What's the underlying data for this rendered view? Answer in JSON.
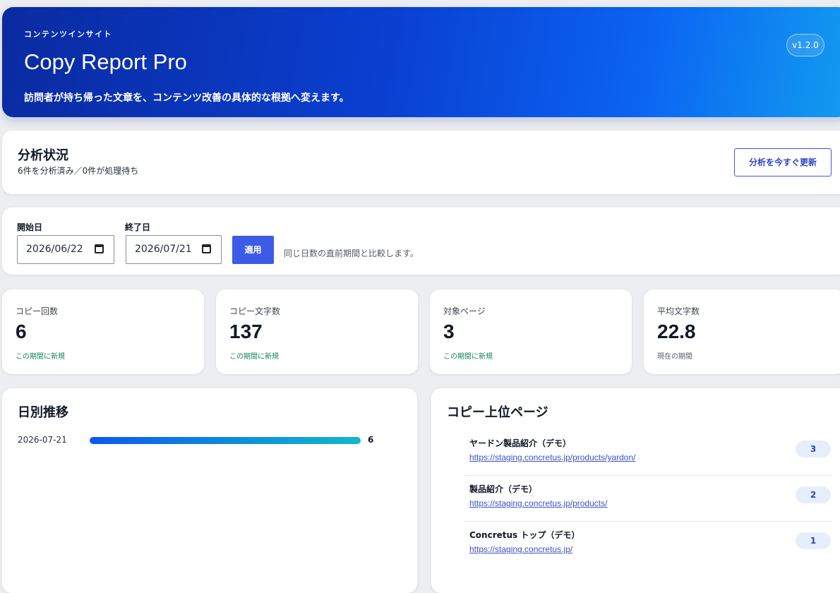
{
  "header": {
    "eyebrow": "コンテンツインサイト",
    "title": "Copy Report Pro",
    "subtitle": "訪問者が持ち帰った文章を、コンテンツ改善の具体的な根拠へ変えます。",
    "version": "v1.2.0"
  },
  "status": {
    "title": "分析状況",
    "summary": "6件を分析済み／0件が処理待ち",
    "refresh_label": "分析を今すぐ更新"
  },
  "filter": {
    "start_label": "開始日",
    "start_value": "2026/06/22",
    "end_label": "終了日",
    "end_value": "2026/07/21",
    "apply_label": "適用",
    "note": "同じ日数の直前期間と比較します。"
  },
  "metrics": [
    {
      "label": "コピー回数",
      "value": "6",
      "note": "この期間に新規"
    },
    {
      "label": "コピー文字数",
      "value": "137",
      "note": "この期間に新規"
    },
    {
      "label": "対象ページ",
      "value": "3",
      "note": "この期間に新規"
    },
    {
      "label": "平均文字数",
      "value": "22.8",
      "note": "現在の期間"
    }
  ],
  "daily": {
    "title": "日別推移",
    "rows": [
      {
        "date": "2026-07-21",
        "value": 6,
        "fill": 1.0
      }
    ]
  },
  "top_pages": {
    "title": "コピー上位ページ",
    "items": [
      {
        "name": "ヤードン製品紹介（デモ）",
        "url": "https://staging.concretus.jp/products/yardon/",
        "count": "3"
      },
      {
        "name": "製品紹介（デモ）",
        "url": "https://staging.concretus.jp/products/",
        "count": "2"
      },
      {
        "name": "Concretus トップ（デモ）",
        "url": "https://staging.concretus.jp/",
        "count": "1"
      }
    ]
  }
}
